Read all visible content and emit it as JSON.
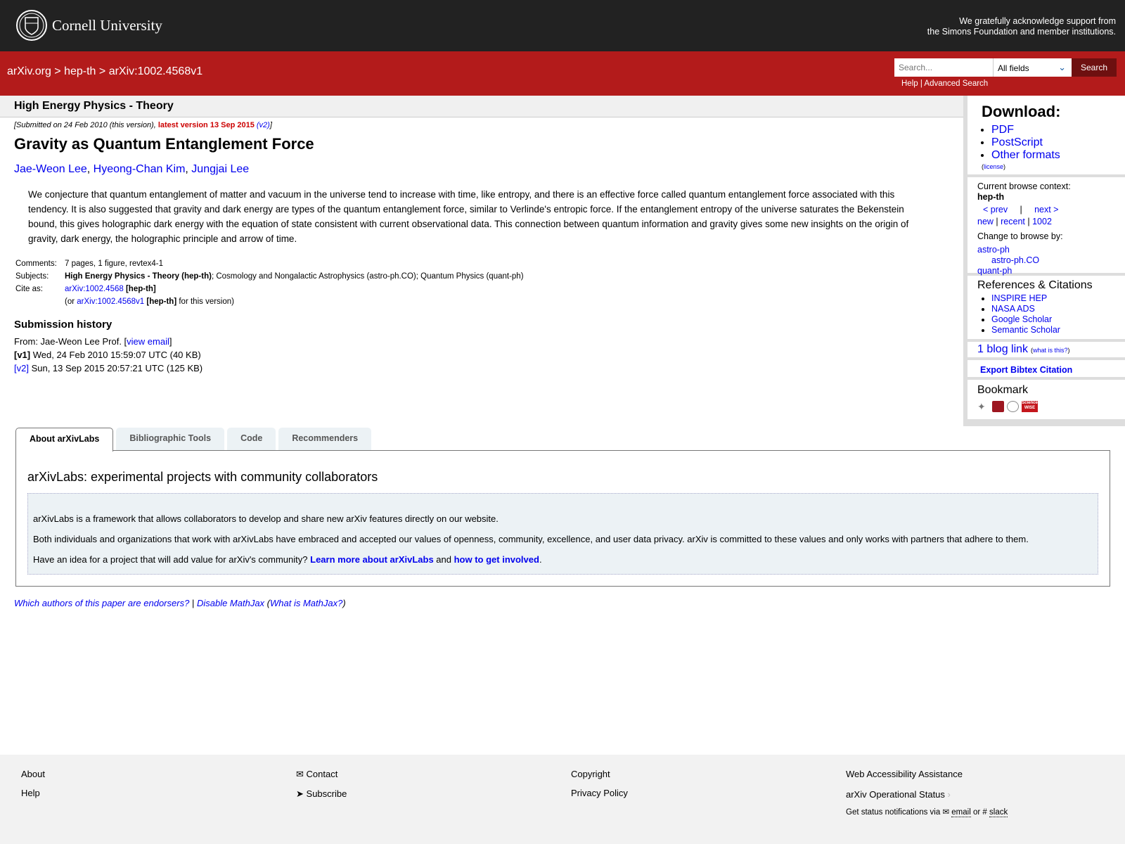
{
  "header": {
    "logo_text": "Cornell University",
    "ack_line1": "We gratefully acknowledge support from",
    "ack_line2": "the Simons Foundation and member institutions."
  },
  "nav": {
    "breadcrumb": [
      "arXiv.org",
      "hep-th",
      "arXiv:1002.4568v1"
    ],
    "search_placeholder": "Search...",
    "field_select": "All fields",
    "search_button": "Search",
    "help": "Help",
    "advanced": "Advanced Search"
  },
  "category": "High Energy Physics - Theory",
  "paper": {
    "submitted": "[Submitted on 24 Feb 2010 (this version), ",
    "latest": "latest version 13 Sep 2015",
    "v2": "(v2)",
    "title": "Gravity as Quantum Entanglement Force",
    "authors": [
      "Jae-Weon Lee",
      "Hyeong-Chan Kim",
      "Jungjai Lee"
    ],
    "abstract": "We conjecture that quantum entanglement of matter and vacuum in the universe tend to increase with time, like entropy, and there is an effective force called quantum entanglement force associated with this tendency. It is also suggested that gravity and dark energy are types of the quantum entanglement force, similar to Verlinde's entropic force. If the entanglement entropy of the universe saturates the Bekenstein bound, this gives holographic dark energy with the equation of state consistent with current observational data. This connection between quantum information and gravity gives some new insights on the origin of gravity, dark energy, the holographic principle and arrow of time.",
    "comments_label": "Comments:",
    "comments": "7 pages, 1 figure, revtex4-1",
    "subjects_label": "Subjects:",
    "subject_primary": "High Energy Physics - Theory (hep-th)",
    "subjects_rest": "; Cosmology and Nongalactic Astrophysics (astro-ph.CO); Quantum Physics (quant-ph)",
    "cite_label": "Cite as:",
    "cite_id": "arXiv:1002.4568",
    "cite_cat": "[hep-th]",
    "cite_v_id": "arXiv:1002.4568v1",
    "cite_v_suffix": "for this version)"
  },
  "history": {
    "title": "Submission history",
    "from": "From: Jae-Weon Lee Prof. ",
    "view_email": "view email",
    "v1": "[v1]",
    "v1_text": " Wed, 24 Feb 2010 15:59:07 UTC (40 KB)",
    "v2": "[v2]",
    "v2_text": " Sun, 13 Sep 2015 20:57:21 UTC (125 KB)"
  },
  "sidebar": {
    "download_title": "Download:",
    "downloads": [
      "PDF",
      "PostScript",
      "Other formats"
    ],
    "license": "license",
    "context_label": "Current browse context:",
    "context": "hep-th",
    "prev": "< prev",
    "next": "next >",
    "new": "new",
    "recent": "recent",
    "month": "1002",
    "change_label": "Change to browse by:",
    "browse": [
      "astro-ph",
      "astro-ph.CO",
      "quant-ph"
    ],
    "refs_title": "References & Citations",
    "refs": [
      "INSPIRE HEP",
      "NASA ADS",
      "Google Scholar",
      "Semantic Scholar"
    ],
    "blog": "1 blog link",
    "whatis": "what is this?",
    "bibtex": "Export Bibtex Citation",
    "bookmark": "Bookmark",
    "bookmark_icons": [
      "bibsonomy-icon",
      "mendeley-icon",
      "reddit-icon",
      "sciencewise-icon"
    ],
    "sciencewise_text": "Science WISE"
  },
  "tabs": [
    "About arXivLabs",
    "Bibliographic Tools",
    "Code",
    "Recommenders"
  ],
  "labs": {
    "title": "arXivLabs: experimental projects with community collaborators",
    "p1": "arXivLabs is a framework that allows collaborators to develop and share new arXiv features directly on our website.",
    "p2": "Both individuals and organizations that work with arXivLabs have embraced and accepted our values of openness, community, excellence, and user data privacy. arXiv is committed to these values and only works with partners that adhere to them.",
    "p3": "Have an idea for a project that will add value for arXiv's community? ",
    "link1": "Learn more about arXivLabs",
    "and": " and ",
    "link2": "how to get involved"
  },
  "endorse": {
    "q": "Which authors of this paper are endorsers?",
    "mathjax": "Disable MathJax",
    "what": "What is MathJax?"
  },
  "footer": {
    "about": "About",
    "help": "Help",
    "contact": "Contact",
    "subscribe": "Subscribe",
    "copyright": "Copyright",
    "privacy": "Privacy Policy",
    "accessibility": "Web Accessibility Assistance",
    "status": "arXiv Operational Status",
    "notif": "Get status notifications via",
    "email": "email",
    "or": "or",
    "slack": "slack"
  },
  "colors": {
    "header_bg": "#222222",
    "brand_red": "#b31b1b",
    "link": "#0000ee"
  }
}
